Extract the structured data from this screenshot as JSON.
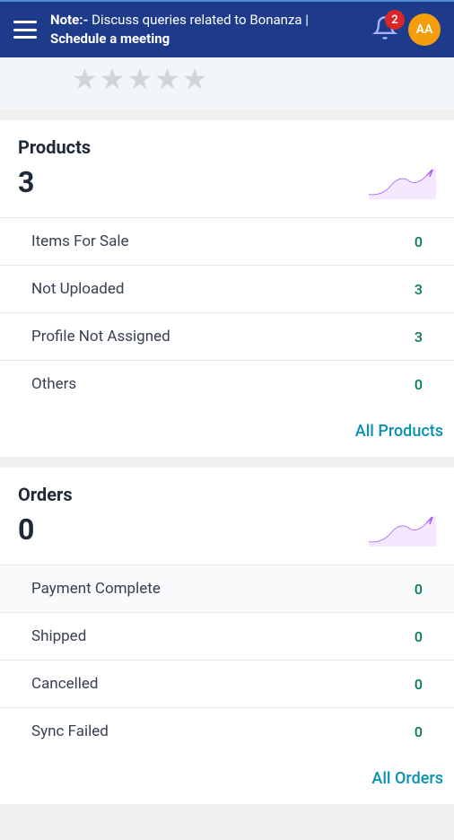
{
  "header": {
    "note_prefix": "Note:-",
    "note_text": " Discuss queries related to Bonanza | ",
    "note_link": "Schedule a meeting",
    "badge_count": "2",
    "avatar_initials": "AA"
  },
  "products": {
    "title": "Products",
    "count": "3",
    "rows": [
      {
        "label": "Items For Sale",
        "value": "0"
      },
      {
        "label": "Not Uploaded",
        "value": "3"
      },
      {
        "label": "Profile Not Assigned",
        "value": "3"
      },
      {
        "label": "Others",
        "value": "0"
      }
    ],
    "footer_link": "All Products"
  },
  "orders": {
    "title": "Orders",
    "count": "0",
    "rows": [
      {
        "label": "Payment Complete",
        "value": "0"
      },
      {
        "label": "Shipped",
        "value": "0"
      },
      {
        "label": "Cancelled",
        "value": "0"
      },
      {
        "label": "Sync Failed",
        "value": "0"
      }
    ],
    "footer_link": "All Orders"
  }
}
